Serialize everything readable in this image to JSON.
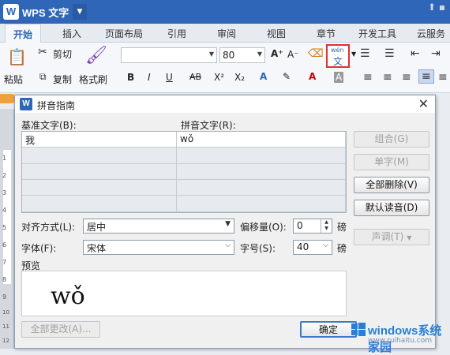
{
  "app": {
    "logo": "W",
    "title": "WPS 文字",
    "menu_arrow": "▼",
    "window_controls": "⬆ ▪"
  },
  "tabs": [
    "开始",
    "插入",
    "页面布局",
    "引用",
    "审阅",
    "视图",
    "章节",
    "开发工具",
    "云服务"
  ],
  "ribbon": {
    "cut": "剪切",
    "paste": "粘贴",
    "copy": "复制",
    "format_painter": "格式刷",
    "font_size": "80",
    "bold": "B",
    "italic": "I",
    "underline": "U",
    "strike": "AB",
    "superscript": "X²",
    "subscript": "X₂",
    "pinyin_top": "wén",
    "pinyin_bottom": "文"
  },
  "ruler_numbers": [
    "1",
    "2",
    "3",
    "4",
    "5",
    "6",
    "7",
    "8",
    "9",
    "10",
    "11",
    "12"
  ],
  "dialog": {
    "title": "拼音指南",
    "close": "✕",
    "base_text_label": "基准文字(B):",
    "ruby_text_label": "拼音文字(R):",
    "rows": [
      {
        "base": "我",
        "ruby": "wǒ"
      },
      {
        "base": "",
        "ruby": ""
      },
      {
        "base": "",
        "ruby": ""
      },
      {
        "base": "",
        "ruby": ""
      },
      {
        "base": "",
        "ruby": ""
      }
    ],
    "buttons": {
      "group": "组合(G)",
      "mono": "单字(M)",
      "clear_all": "全部删除(V)",
      "default_reading": "默认读音(D)",
      "tone": "声调(T)",
      "apply_all": "全部更改(A)...",
      "ok": "确定"
    },
    "alignment_label": "对齐方式(L):",
    "alignment_value": "居中",
    "offset_label": "偏移量(O):",
    "offset_value": "0",
    "offset_unit": "磅",
    "font_label": "字体(F):",
    "font_value": "宋体",
    "size_label": "字号(S):",
    "size_value": "40",
    "size_unit": "磅",
    "preview_label": "预览",
    "preview_text": "wǒ"
  },
  "watermark": {
    "title": "windows系统家园",
    "url": "www.ruihaitu.com"
  },
  "colors": {
    "accent": "#2f66b8",
    "highlight_border": "#e03030"
  }
}
